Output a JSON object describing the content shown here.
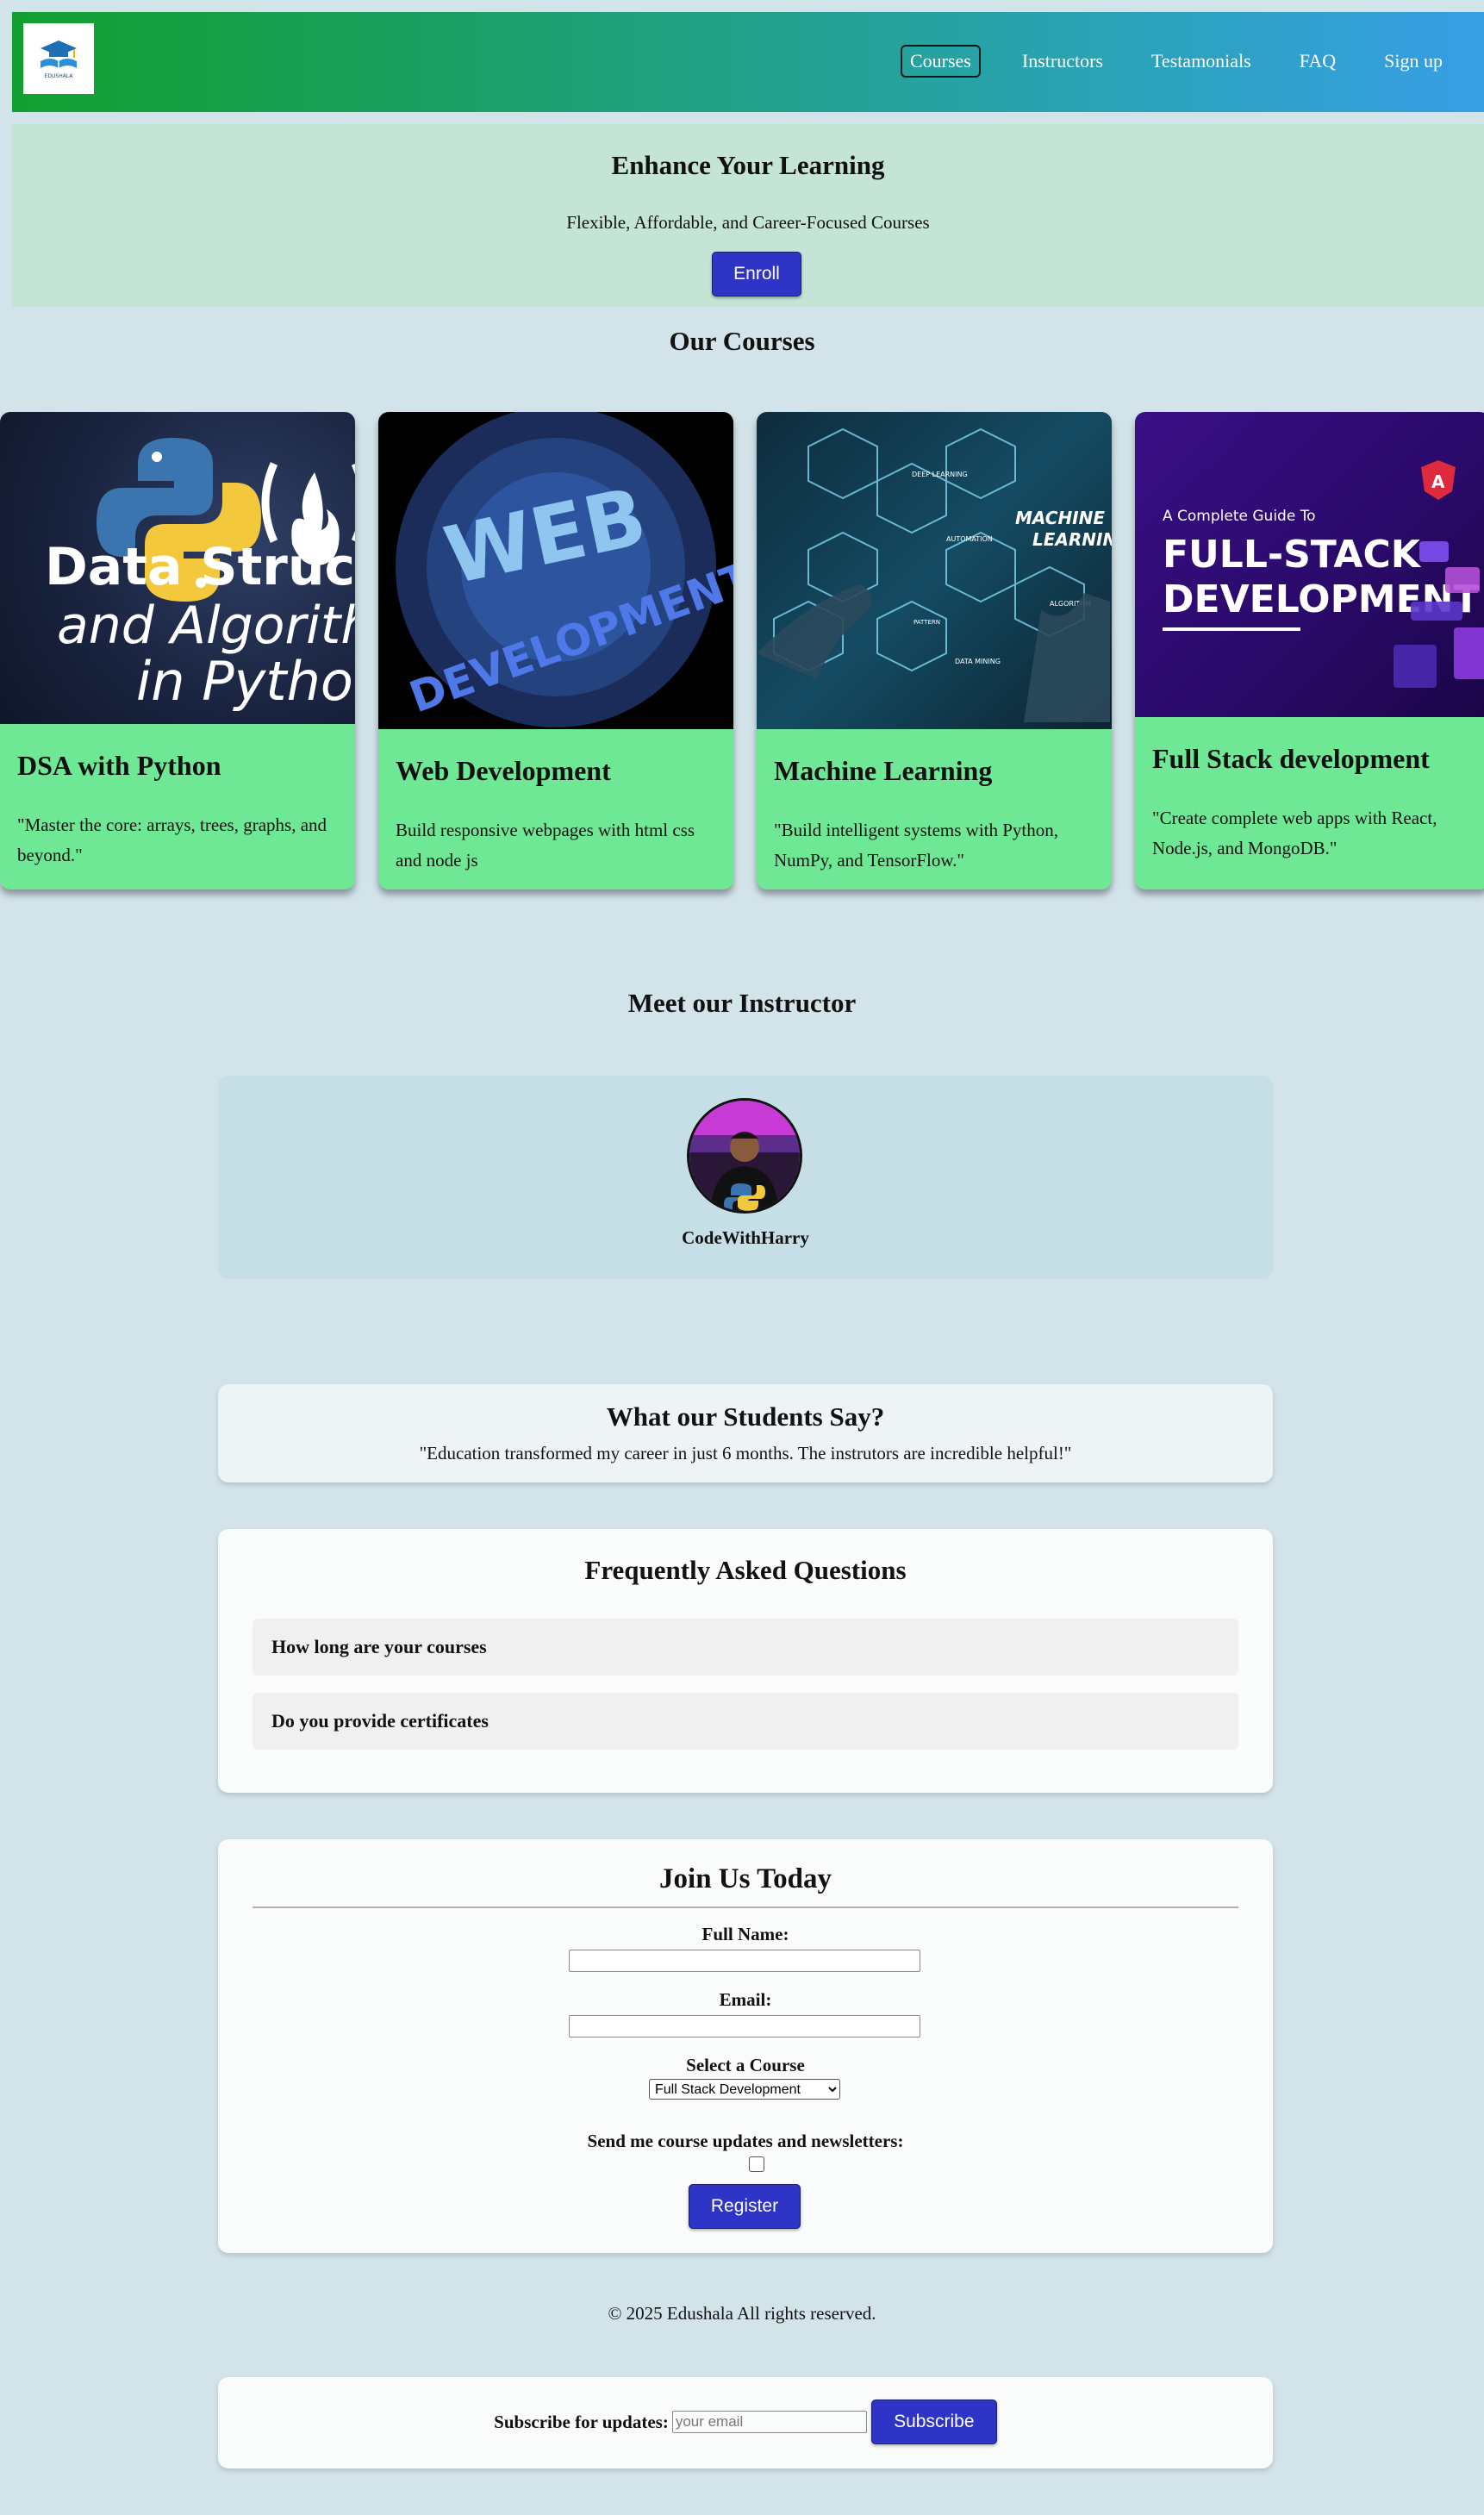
{
  "colors": {
    "nav_gradient_start": "#11a02f",
    "nav_gradient_end": "#379ee5",
    "hero_bg": "#c4e4d5",
    "page_bg": "#d2e4ea",
    "card_bg": "#6fe896",
    "button_bg": "#2e35c6"
  },
  "nav": {
    "logo_icon": "graduation-cap-book-icon",
    "logo_text": "EDUSHALA",
    "links": [
      "Courses",
      "Instructors",
      "Testamonials",
      "FAQ",
      "Sign up"
    ],
    "active": "Courses"
  },
  "hero": {
    "title": "Enhance Your Learning",
    "subtitle": "Flexible, Affordable, and Career-Focused Courses",
    "button": "Enroll"
  },
  "courses_section": {
    "title": "Our Courses",
    "cards": [
      {
        "title": "DSA with Python",
        "desc": "\"Master the core: arrays, trees, graphs, and beyond.\"",
        "img_text": [
          "Data Structu",
          "and Algorith",
          "in Python"
        ]
      },
      {
        "title": "Web Development",
        "desc": "Build responsive webpages with html css and node js",
        "img_text": [
          "WEB",
          "DEVELOPMENT"
        ]
      },
      {
        "title": "Machine Learning",
        "desc": "\"Build intelligent systems with Python, NumPy, and TensorFlow.\"",
        "img_text": [
          "MACHINE",
          "LEARNING",
          "DEEP LEARNING",
          "AUTOMATION",
          "ALGORITHM",
          "DATA MINING",
          "PATTERN"
        ]
      },
      {
        "title": "Full Stack development",
        "desc": "\"Create complete web apps with React, Node.js, and MongoDB.\"",
        "img_text": [
          "A Complete Guide To",
          "FULL-STACK",
          "DEVELOPMENT"
        ]
      }
    ]
  },
  "instructor_section": {
    "title": "Meet our Instructor",
    "name": "CodeWithHarry"
  },
  "testimonials": {
    "title": "What our Students Say?",
    "quote": "\"Education transformed my career in just 6 months. The instrutors are incredible helpful!\""
  },
  "faq": {
    "title": "Frequently Asked Questions",
    "items": [
      "How long are your courses",
      "Do you provide certificates"
    ]
  },
  "join": {
    "title": "Join Us Today",
    "name_label": "Full Name:",
    "email_label": "Email:",
    "course_label": "Select a Course",
    "course_selected": "Full Stack Development",
    "newsletter_label": "Send me course updates and newsletters:",
    "newsletter_checked": false,
    "button": "Register"
  },
  "footer": {
    "copyright": "© 2025 Edushala All rights reserved."
  },
  "subscribe": {
    "label": "Subscribe for updates:",
    "placeholder": "your email",
    "button": "Subscribe"
  }
}
